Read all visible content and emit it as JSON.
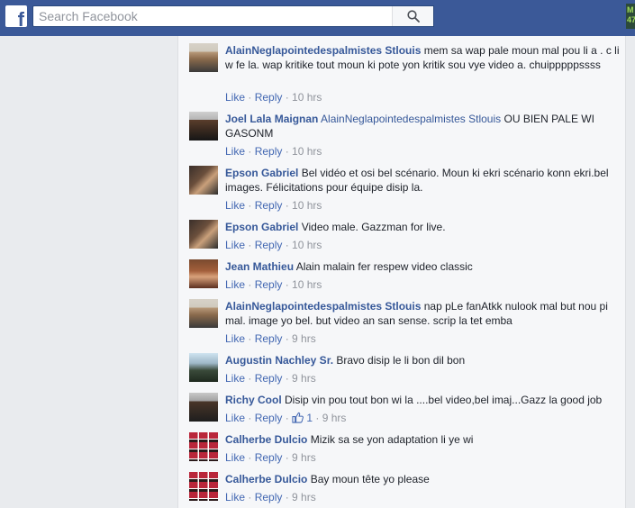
{
  "topbar": {
    "logo": "f",
    "search_placeholder": "Search Facebook",
    "search_icon": "magnifier-icon",
    "corner_text": "M\n47"
  },
  "colors": {
    "brand": "#3b5998",
    "link": "#365899",
    "meta": "#90949c"
  },
  "comments": [
    {
      "author": "AlainNeglapointedespalmistes Stlouis",
      "mention": "",
      "text": "mem sa wap pale moun mal pou li a . c li w fe la. wap kritike tout moun ki pote yon kritik sou vye video a. chuipppppssss",
      "like": "Like",
      "reply": "Reply",
      "likes": "",
      "time": "10 hrs"
    },
    {
      "author": "Joel Lala Maignan",
      "mention": "AlainNeglapointedespalmistes Stlouis",
      "text": "OU BIEN PALE WI GASONM",
      "like": "Like",
      "reply": "Reply",
      "likes": "",
      "time": "10 hrs"
    },
    {
      "author": "Epson Gabriel",
      "mention": "",
      "text": "Bel vidéo et osi bel scénario. Moun ki ekri scénario konn ekri.bel images. Félicitations pour équipe disip la.",
      "like": "Like",
      "reply": "Reply",
      "likes": "",
      "time": "10 hrs"
    },
    {
      "author": "Epson Gabriel",
      "mention": "",
      "text": "Video male. Gazzman for live.",
      "like": "Like",
      "reply": "Reply",
      "likes": "",
      "time": "10 hrs"
    },
    {
      "author": "Jean Mathieu",
      "mention": "",
      "text": "Alain malain fer respew video classic",
      "like": "Like",
      "reply": "Reply",
      "likes": "",
      "time": "10 hrs"
    },
    {
      "author": "AlainNeglapointedespalmistes Stlouis",
      "mention": "",
      "text": "nap pLe fanAtkk nulook mal but nou pi mal. image yo bel. but video an san sense. scrip la tet emba",
      "like": "Like",
      "reply": "Reply",
      "likes": "",
      "time": "9 hrs"
    },
    {
      "author": "Augustin Nachley Sr.",
      "mention": "",
      "text": "Bravo disip le li bon dil bon",
      "like": "Like",
      "reply": "Reply",
      "likes": "",
      "time": "9 hrs"
    },
    {
      "author": "Richy Cool",
      "mention": "",
      "text": "Disip vin pou tout bon wi la ....bel video,bel imaj...Gazz la good job",
      "like": "Like",
      "reply": "Reply",
      "likes": "1",
      "time": "9 hrs"
    },
    {
      "author": "Calherbe Dulcio",
      "mention": "",
      "text": "Mizik sa se yon adaptation li ye wi",
      "like": "Like",
      "reply": "Reply",
      "likes": "",
      "time": "9 hrs"
    },
    {
      "author": "Calherbe Dulcio",
      "mention": "",
      "text": "Bay moun tête yo please",
      "like": "Like",
      "reply": "Reply",
      "likes": "",
      "time": "9 hrs"
    }
  ]
}
